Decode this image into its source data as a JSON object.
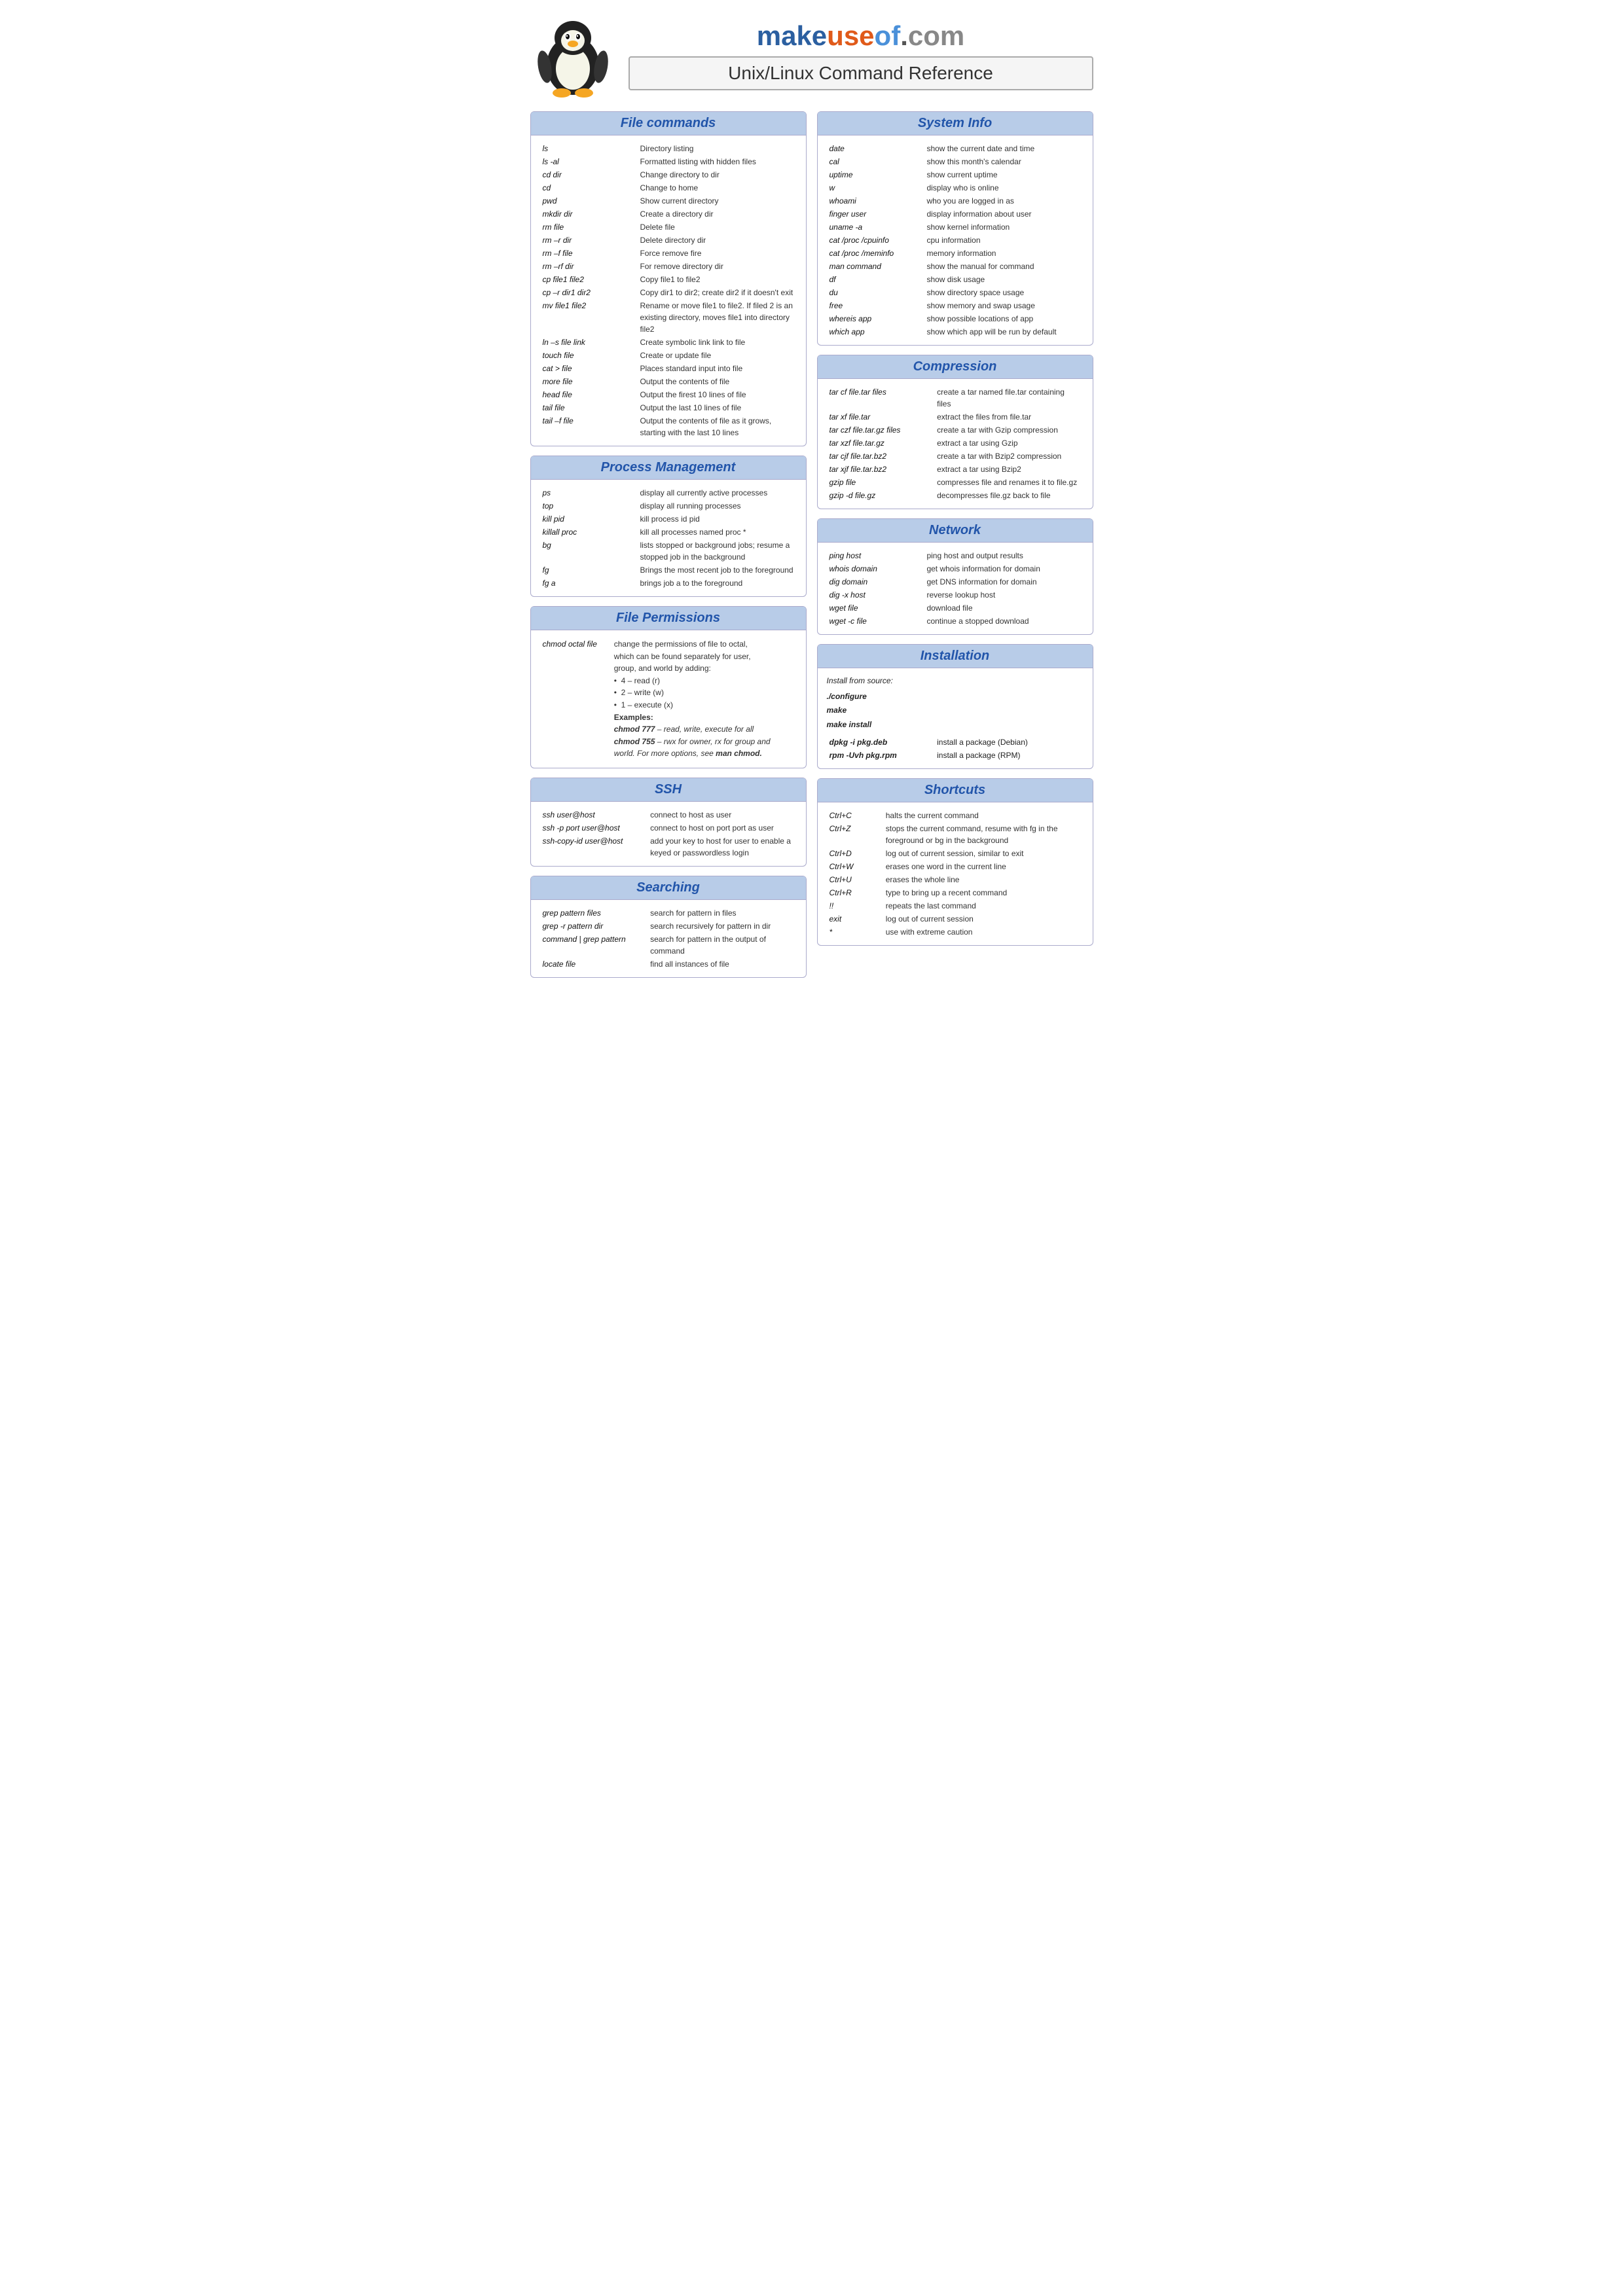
{
  "header": {
    "site": "makeuseof.com",
    "title": "Unix/Linux Command Reference"
  },
  "sections": {
    "file_commands": {
      "title": "File commands",
      "commands": [
        {
          "cmd": "ls",
          "desc": "Directory listing"
        },
        {
          "cmd": "ls -al",
          "desc": "Formatted listing with hidden files"
        },
        {
          "cmd": "cd dir",
          "desc": "Change directory to dir"
        },
        {
          "cmd": "cd",
          "desc": "Change to home"
        },
        {
          "cmd": "pwd",
          "desc": "Show current directory"
        },
        {
          "cmd": "mkdir dir",
          "desc": "Create a directory dir"
        },
        {
          "cmd": "rm file",
          "desc": "Delete file"
        },
        {
          "cmd": "rm –r dir",
          "desc": "Delete directory dir"
        },
        {
          "cmd": "rm –f file",
          "desc": "Force remove fire"
        },
        {
          "cmd": "rm –rf dir",
          "desc": "For remove directory dir"
        },
        {
          "cmd": "cp file1 file2",
          "desc": "Copy file1 to file2"
        },
        {
          "cmd": "cp –r dir1 dir2",
          "desc": "Copy dir1 to dir2; create dir2 if it doesn't exit"
        },
        {
          "cmd": "mv file1 file2",
          "desc": "Rename or move file1 to file2. If filed 2 is an existing directory, moves file1 into directory  file2"
        },
        {
          "cmd": "ln –s file link",
          "desc": "Create symbolic link link to file"
        },
        {
          "cmd": "touch file",
          "desc": "Create or update file"
        },
        {
          "cmd": "cat > file",
          "desc": "Places standard input into file"
        },
        {
          "cmd": "more file",
          "desc": "Output the contents of file"
        },
        {
          "cmd": "head file",
          "desc": "Output the firest 10 lines of file"
        },
        {
          "cmd": "tail file",
          "desc": "Output the last 10 lines of file"
        },
        {
          "cmd": "tail –f file",
          "desc": "Output the contents of file as it grows, starting with the last 10 lines"
        }
      ]
    },
    "process_management": {
      "title": "Process Management",
      "commands": [
        {
          "cmd": "ps",
          "desc": "display all currently active processes"
        },
        {
          "cmd": "top",
          "desc": "display all running processes"
        },
        {
          "cmd": "kill pid",
          "desc": "kill process id pid"
        },
        {
          "cmd": "killall proc",
          "desc": "kill all processes named proc *"
        },
        {
          "cmd": "bg",
          "desc": "lists stopped or background jobs; resume a stopped job in the background"
        },
        {
          "cmd": "fg",
          "desc": "Brings the most recent job to the foreground"
        },
        {
          "cmd": "fg a",
          "desc": "brings job a to the foreground"
        }
      ]
    },
    "file_permissions": {
      "title": "File Permissions",
      "cmd": "chmod octal file",
      "desc_lines": [
        "change the permissions of file to octal,",
        "which can be found separately for user,",
        "group, and world by adding:",
        "•  4 – read (r)",
        "•  2 – write (w)",
        "•  1 – execute (x)",
        "Examples:",
        "chmod 777 – read, write, execute for all",
        "chmod 755 – rwx for owner, rx for group and",
        "world. For more options, see man chmod."
      ]
    },
    "ssh": {
      "title": "SSH",
      "commands": [
        {
          "cmd": "ssh user@host",
          "desc": "connect to host as user"
        },
        {
          "cmd": "ssh -p port user@host",
          "desc": "connect to host on port port as user"
        },
        {
          "cmd": "ssh-copy-id user@host",
          "desc": "add your key to host for user to enable a keyed or passwordless login"
        }
      ]
    },
    "searching": {
      "title": "Searching",
      "commands": [
        {
          "cmd": "grep pattern files",
          "desc": "search for pattern in files"
        },
        {
          "cmd": "grep -r pattern dir",
          "desc": "search recursively for pattern in dir"
        },
        {
          "cmd": "command | grep pattern",
          "desc": "search for pattern in the output of command"
        },
        {
          "cmd": "locate file",
          "desc": "find all instances of file"
        }
      ]
    },
    "system_info": {
      "title": "System Info",
      "commands": [
        {
          "cmd": "date",
          "desc": "show the current date and time"
        },
        {
          "cmd": "cal",
          "desc": "show this month's calendar"
        },
        {
          "cmd": "uptime",
          "desc": "show current uptime"
        },
        {
          "cmd": "w",
          "desc": "display who is online"
        },
        {
          "cmd": "whoami",
          "desc": "who you are logged in as"
        },
        {
          "cmd": "finger user",
          "desc": "display information about user"
        },
        {
          "cmd": "uname -a",
          "desc": "show kernel information"
        },
        {
          "cmd": "cat /proc /cpuinfo",
          "desc": "cpu information"
        },
        {
          "cmd": "cat /proc /meminfo",
          "desc": "memory information"
        },
        {
          "cmd": "man command",
          "desc": "show the manual for command"
        },
        {
          "cmd": "df",
          "desc": "show disk usage"
        },
        {
          "cmd": "du",
          "desc": "show directory space usage"
        },
        {
          "cmd": "free",
          "desc": "show memory and swap usage"
        },
        {
          "cmd": "whereis app",
          "desc": "show possible locations of app"
        },
        {
          "cmd": "which app",
          "desc": "show which app will be run by default"
        }
      ]
    },
    "compression": {
      "title": "Compression",
      "commands": [
        {
          "cmd": "tar cf file.tar files",
          "desc": "create a tar named file.tar containing files"
        },
        {
          "cmd": "tar xf file.tar",
          "desc": "extract the files from file.tar"
        },
        {
          "cmd": "tar czf file.tar.gz files",
          "desc": "create a tar with Gzip compression"
        },
        {
          "cmd": "tar xzf file.tar.gz",
          "desc": "extract a tar using Gzip"
        },
        {
          "cmd": "tar cjf file.tar.bz2",
          "desc": "create a tar with Bzip2 compression"
        },
        {
          "cmd": "tar xjf file.tar.bz2",
          "desc": "extract a tar using Bzip2"
        },
        {
          "cmd": "gzip file",
          "desc": "compresses file and renames it to file.gz"
        },
        {
          "cmd": "gzip -d file.gz",
          "desc": "decompresses file.gz back to file"
        }
      ]
    },
    "network": {
      "title": "Network",
      "commands": [
        {
          "cmd": "ping host",
          "desc": "ping host and output results"
        },
        {
          "cmd": "whois domain",
          "desc": "get whois information for domain"
        },
        {
          "cmd": "dig domain",
          "desc": "get DNS information for domain"
        },
        {
          "cmd": "dig -x host",
          "desc": "reverse lookup host"
        },
        {
          "cmd": "wget file",
          "desc": "download file"
        },
        {
          "cmd": "wget -c file",
          "desc": "continue a stopped download"
        }
      ]
    },
    "installation": {
      "title": "Installation",
      "source_label": "Install from source:",
      "source_commands": [
        "./configure",
        "make",
        "make install"
      ],
      "pkg_commands": [
        {
          "cmd": "dpkg -i pkg.deb",
          "desc": "install a package (Debian)"
        },
        {
          "cmd": "rpm -Uvh pkg.rpm",
          "desc": "install a package (RPM)"
        }
      ]
    },
    "shortcuts": {
      "title": "Shortcuts",
      "commands": [
        {
          "cmd": "Ctrl+C",
          "desc": "halts the current command"
        },
        {
          "cmd": "Ctrl+Z",
          "desc": "stops the current command, resume with fg in the foreground or bg in the background"
        },
        {
          "cmd": "Ctrl+D",
          "desc": "log out of current session, similar to exit"
        },
        {
          "cmd": "Ctrl+W",
          "desc": "erases one word in the current line"
        },
        {
          "cmd": "Ctrl+U",
          "desc": "erases the whole line"
        },
        {
          "cmd": "Ctrl+R",
          "desc": "type to bring up a recent command"
        },
        {
          "cmd": "!!",
          "desc": "repeats the last command"
        },
        {
          "cmd": "exit",
          "desc": "log out of current session"
        },
        {
          "cmd": "*",
          "desc": "use with extreme caution"
        }
      ]
    }
  }
}
